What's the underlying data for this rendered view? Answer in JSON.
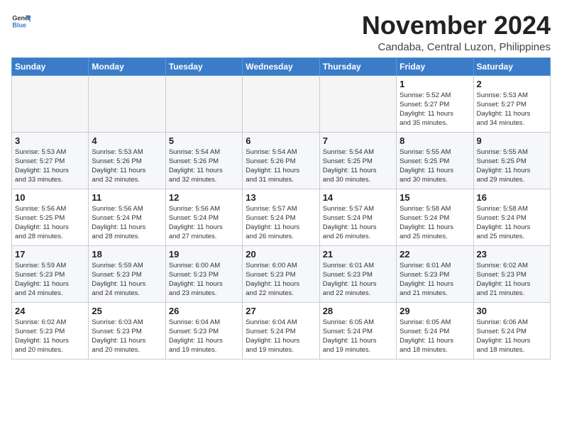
{
  "header": {
    "logo_line1": "General",
    "logo_line2": "Blue",
    "month": "November 2024",
    "location": "Candaba, Central Luzon, Philippines"
  },
  "weekdays": [
    "Sunday",
    "Monday",
    "Tuesday",
    "Wednesday",
    "Thursday",
    "Friday",
    "Saturday"
  ],
  "weeks": [
    [
      {
        "day": "",
        "info": ""
      },
      {
        "day": "",
        "info": ""
      },
      {
        "day": "",
        "info": ""
      },
      {
        "day": "",
        "info": ""
      },
      {
        "day": "",
        "info": ""
      },
      {
        "day": "1",
        "info": "Sunrise: 5:52 AM\nSunset: 5:27 PM\nDaylight: 11 hours\nand 35 minutes."
      },
      {
        "day": "2",
        "info": "Sunrise: 5:53 AM\nSunset: 5:27 PM\nDaylight: 11 hours\nand 34 minutes."
      }
    ],
    [
      {
        "day": "3",
        "info": "Sunrise: 5:53 AM\nSunset: 5:27 PM\nDaylight: 11 hours\nand 33 minutes."
      },
      {
        "day": "4",
        "info": "Sunrise: 5:53 AM\nSunset: 5:26 PM\nDaylight: 11 hours\nand 32 minutes."
      },
      {
        "day": "5",
        "info": "Sunrise: 5:54 AM\nSunset: 5:26 PM\nDaylight: 11 hours\nand 32 minutes."
      },
      {
        "day": "6",
        "info": "Sunrise: 5:54 AM\nSunset: 5:26 PM\nDaylight: 11 hours\nand 31 minutes."
      },
      {
        "day": "7",
        "info": "Sunrise: 5:54 AM\nSunset: 5:25 PM\nDaylight: 11 hours\nand 30 minutes."
      },
      {
        "day": "8",
        "info": "Sunrise: 5:55 AM\nSunset: 5:25 PM\nDaylight: 11 hours\nand 30 minutes."
      },
      {
        "day": "9",
        "info": "Sunrise: 5:55 AM\nSunset: 5:25 PM\nDaylight: 11 hours\nand 29 minutes."
      }
    ],
    [
      {
        "day": "10",
        "info": "Sunrise: 5:56 AM\nSunset: 5:25 PM\nDaylight: 11 hours\nand 28 minutes."
      },
      {
        "day": "11",
        "info": "Sunrise: 5:56 AM\nSunset: 5:24 PM\nDaylight: 11 hours\nand 28 minutes."
      },
      {
        "day": "12",
        "info": "Sunrise: 5:56 AM\nSunset: 5:24 PM\nDaylight: 11 hours\nand 27 minutes."
      },
      {
        "day": "13",
        "info": "Sunrise: 5:57 AM\nSunset: 5:24 PM\nDaylight: 11 hours\nand 26 minutes."
      },
      {
        "day": "14",
        "info": "Sunrise: 5:57 AM\nSunset: 5:24 PM\nDaylight: 11 hours\nand 26 minutes."
      },
      {
        "day": "15",
        "info": "Sunrise: 5:58 AM\nSunset: 5:24 PM\nDaylight: 11 hours\nand 25 minutes."
      },
      {
        "day": "16",
        "info": "Sunrise: 5:58 AM\nSunset: 5:24 PM\nDaylight: 11 hours\nand 25 minutes."
      }
    ],
    [
      {
        "day": "17",
        "info": "Sunrise: 5:59 AM\nSunset: 5:23 PM\nDaylight: 11 hours\nand 24 minutes."
      },
      {
        "day": "18",
        "info": "Sunrise: 5:59 AM\nSunset: 5:23 PM\nDaylight: 11 hours\nand 24 minutes."
      },
      {
        "day": "19",
        "info": "Sunrise: 6:00 AM\nSunset: 5:23 PM\nDaylight: 11 hours\nand 23 minutes."
      },
      {
        "day": "20",
        "info": "Sunrise: 6:00 AM\nSunset: 5:23 PM\nDaylight: 11 hours\nand 22 minutes."
      },
      {
        "day": "21",
        "info": "Sunrise: 6:01 AM\nSunset: 5:23 PM\nDaylight: 11 hours\nand 22 minutes."
      },
      {
        "day": "22",
        "info": "Sunrise: 6:01 AM\nSunset: 5:23 PM\nDaylight: 11 hours\nand 21 minutes."
      },
      {
        "day": "23",
        "info": "Sunrise: 6:02 AM\nSunset: 5:23 PM\nDaylight: 11 hours\nand 21 minutes."
      }
    ],
    [
      {
        "day": "24",
        "info": "Sunrise: 6:02 AM\nSunset: 5:23 PM\nDaylight: 11 hours\nand 20 minutes."
      },
      {
        "day": "25",
        "info": "Sunrise: 6:03 AM\nSunset: 5:23 PM\nDaylight: 11 hours\nand 20 minutes."
      },
      {
        "day": "26",
        "info": "Sunrise: 6:04 AM\nSunset: 5:23 PM\nDaylight: 11 hours\nand 19 minutes."
      },
      {
        "day": "27",
        "info": "Sunrise: 6:04 AM\nSunset: 5:24 PM\nDaylight: 11 hours\nand 19 minutes."
      },
      {
        "day": "28",
        "info": "Sunrise: 6:05 AM\nSunset: 5:24 PM\nDaylight: 11 hours\nand 19 minutes."
      },
      {
        "day": "29",
        "info": "Sunrise: 6:05 AM\nSunset: 5:24 PM\nDaylight: 11 hours\nand 18 minutes."
      },
      {
        "day": "30",
        "info": "Sunrise: 6:06 AM\nSunset: 5:24 PM\nDaylight: 11 hours\nand 18 minutes."
      }
    ]
  ]
}
